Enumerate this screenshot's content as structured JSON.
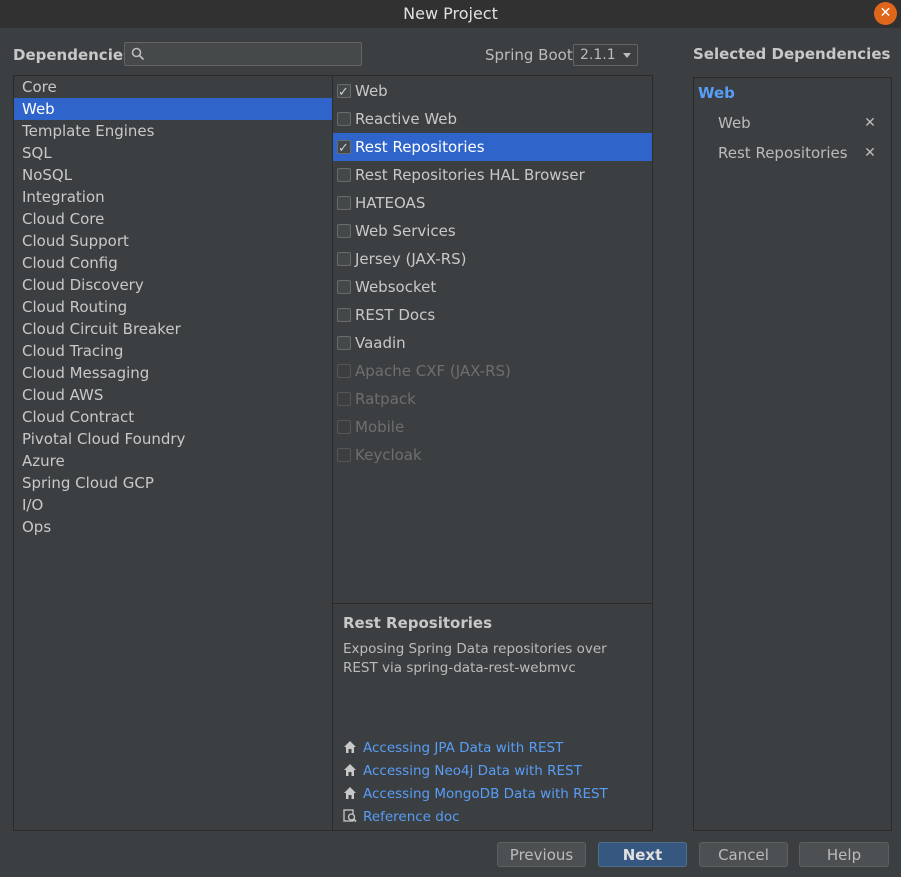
{
  "window": {
    "title": "New Project",
    "close_symbol": "✕"
  },
  "header": {
    "dependencies_label": "Dependencies",
    "search": {
      "value": "",
      "placeholder": ""
    },
    "spring_boot_label": "Spring Boot",
    "spring_boot_version": "2.1.1"
  },
  "categories": [
    "Core",
    "Web",
    "Template Engines",
    "SQL",
    "NoSQL",
    "Integration",
    "Cloud Core",
    "Cloud Support",
    "Cloud Config",
    "Cloud Discovery",
    "Cloud Routing",
    "Cloud Circuit Breaker",
    "Cloud Tracing",
    "Cloud Messaging",
    "Cloud AWS",
    "Cloud Contract",
    "Pivotal Cloud Foundry",
    "Azure",
    "Spring Cloud GCP",
    "I/O",
    "Ops"
  ],
  "selected_category": "Web",
  "dependencies": [
    {
      "label": "Web",
      "checked": true,
      "enabled": true
    },
    {
      "label": "Reactive Web",
      "checked": false,
      "enabled": true
    },
    {
      "label": "Rest Repositories",
      "checked": true,
      "enabled": true
    },
    {
      "label": "Rest Repositories HAL Browser",
      "checked": false,
      "enabled": true
    },
    {
      "label": "HATEOAS",
      "checked": false,
      "enabled": true
    },
    {
      "label": "Web Services",
      "checked": false,
      "enabled": true
    },
    {
      "label": "Jersey (JAX-RS)",
      "checked": false,
      "enabled": true
    },
    {
      "label": "Websocket",
      "checked": false,
      "enabled": true
    },
    {
      "label": "REST Docs",
      "checked": false,
      "enabled": true
    },
    {
      "label": "Vaadin",
      "checked": false,
      "enabled": true
    },
    {
      "label": "Apache CXF (JAX-RS)",
      "checked": false,
      "enabled": false
    },
    {
      "label": "Ratpack",
      "checked": false,
      "enabled": false
    },
    {
      "label": "Mobile",
      "checked": false,
      "enabled": false
    },
    {
      "label": "Keycloak",
      "checked": false,
      "enabled": false
    }
  ],
  "highlighted_dependency": "Rest Repositories",
  "description": {
    "title": "Rest Repositories",
    "text": "Exposing Spring Data repositories over REST via spring-data-rest-webmvc",
    "links": [
      {
        "label": "Accessing JPA Data with REST",
        "icon": "home-icon"
      },
      {
        "label": "Accessing Neo4j Data with REST",
        "icon": "home-icon"
      },
      {
        "label": "Accessing MongoDB Data with REST",
        "icon": "home-icon"
      },
      {
        "label": "Reference doc",
        "icon": "doc-search-icon"
      }
    ]
  },
  "selected_dependencies": {
    "title": "Selected Dependencies",
    "group": "Web",
    "items": [
      {
        "label": "Web",
        "remove_symbol": "✕"
      },
      {
        "label": "Rest Repositories",
        "remove_symbol": "✕"
      }
    ]
  },
  "buttons": {
    "previous": "Previous",
    "next": "Next",
    "cancel": "Cancel",
    "help": "Help"
  },
  "colors": {
    "selection": "#2f65ca",
    "link": "#589df6",
    "close": "#e0661c"
  }
}
